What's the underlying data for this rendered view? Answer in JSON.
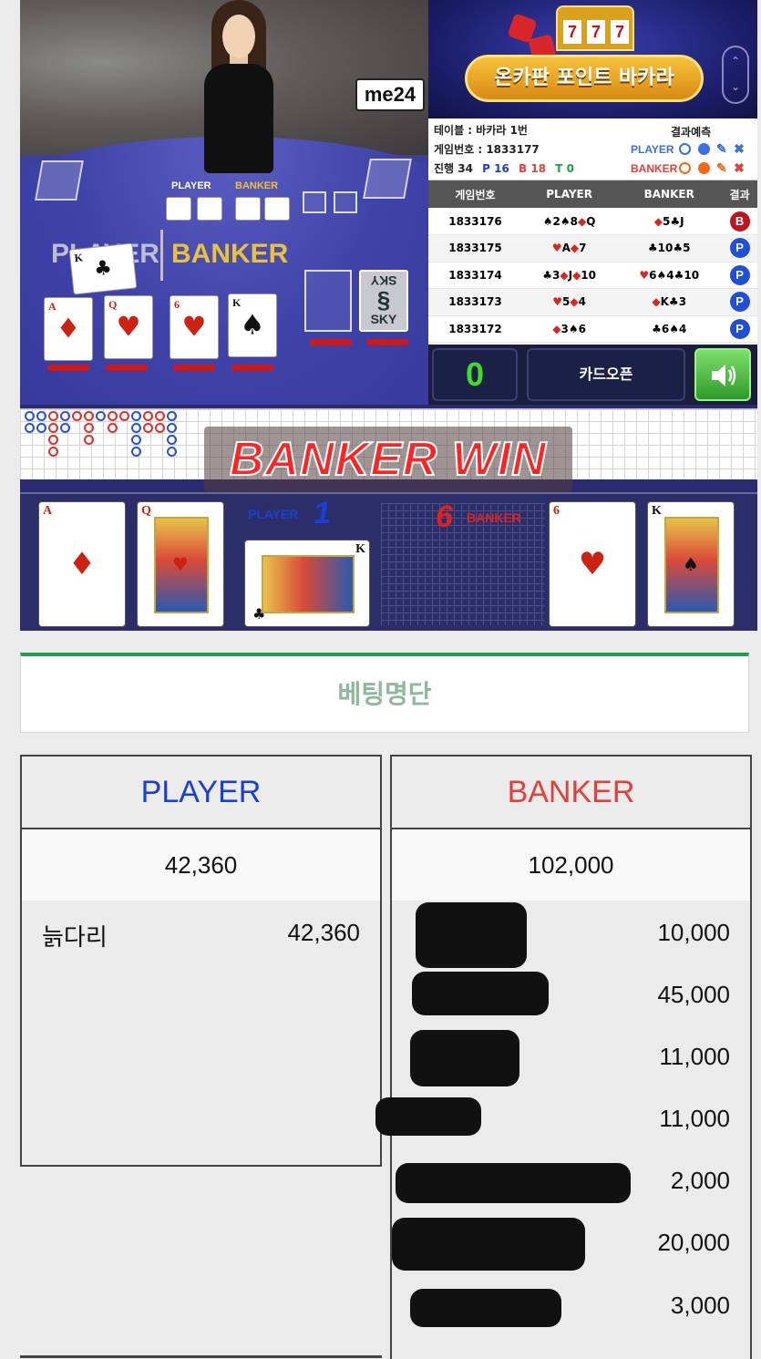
{
  "stream": {
    "logo": "me24",
    "table_player_label": "PLAYER",
    "table_banker_label": "BANKER",
    "mini_player_label": "PLAYER",
    "mini_banker_label": "BANKER",
    "sky_card_top": "SKY",
    "sky_card_bottom": "SKY"
  },
  "banner": {
    "title": "온카판 포인트 바카라",
    "slot_reels": [
      "7",
      "7",
      "7"
    ]
  },
  "info": {
    "table": "테이블 : 바카라 1번",
    "game_number": "게임번호 : 1833177",
    "progress_label": "진행",
    "progress": "34",
    "player_count": "P 16",
    "banker_count": "B 18",
    "tie_count": "T 0",
    "prediction_title": "결과예측",
    "player_label": "PLAYER",
    "banker_label": "BANKER"
  },
  "history": {
    "headers": [
      "게임번호",
      "PLAYER",
      "BANKER",
      "결과"
    ],
    "rows": [
      {
        "game": "1833176",
        "player": "♠2♠8◆Q",
        "banker": "◆5♣J",
        "result": "B"
      },
      {
        "game": "1833175",
        "player": "♥A◆7",
        "banker": "♣10♣5",
        "result": "P"
      },
      {
        "game": "1833174",
        "player": "♣3◆J◆10",
        "banker": "♥6♠4♣10",
        "result": "P"
      },
      {
        "game": "1833173",
        "player": "♥5◆4",
        "banker": "◆K♣3",
        "result": "P"
      },
      {
        "game": "1833172",
        "player": "◆3♠6",
        "banker": "♣6♠4",
        "result": "P"
      }
    ]
  },
  "controls": {
    "countdown": "0",
    "card_open_label": "카드오픈"
  },
  "result": {
    "banner_text": "BANKER WIN",
    "player_label": "PLAYER",
    "player_score": "1",
    "banker_label": "BANKER",
    "banker_score": "6",
    "player_cards": [
      {
        "rank": "A",
        "suit": "♦"
      },
      {
        "rank": "Q",
        "suit": "♥"
      },
      {
        "rank": "K",
        "suit": "♣"
      }
    ],
    "banker_cards": [
      {
        "rank": "6",
        "suit": "♥"
      },
      {
        "rank": "K",
        "suit": "♠"
      }
    ]
  },
  "betting": {
    "header": "베팅명단",
    "player": {
      "title": "PLAYER",
      "total": "42,360",
      "rows": [
        {
          "name": "늙다리",
          "amount": "42,360"
        }
      ]
    },
    "banker": {
      "title": "BANKER",
      "total": "102,000",
      "rows": [
        {
          "amount": "10,000"
        },
        {
          "amount": "45,000"
        },
        {
          "amount": "11,000"
        },
        {
          "amount": "11,000"
        },
        {
          "amount": "2,000"
        },
        {
          "amount": "20,000"
        },
        {
          "amount": "3,000"
        }
      ]
    }
  },
  "colors": {
    "player": "#1a3fd6",
    "banker": "#e0413a",
    "accent_green": "#1fa04a"
  }
}
